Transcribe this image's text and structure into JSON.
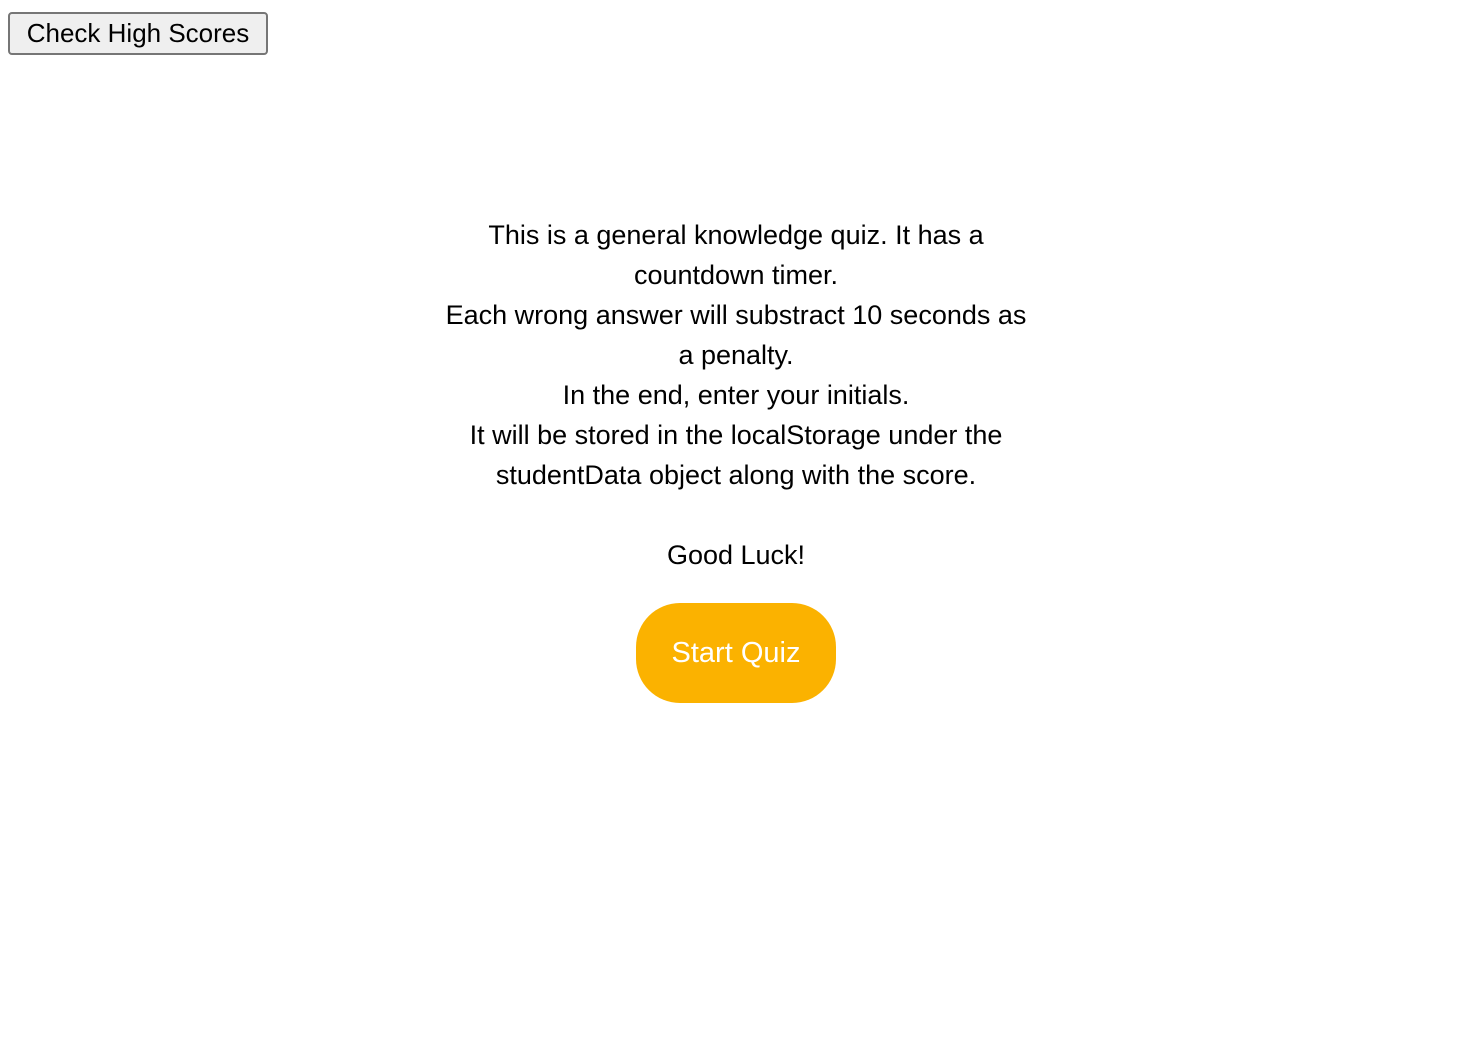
{
  "header": {
    "highscores_label": "Check High Scores"
  },
  "intro": {
    "line1": "This is a general knowledge quiz. It has a countdown timer.",
    "line2": "Each wrong answer will substract 10 seconds as a penalty.",
    "line3": "In the end, enter your initials.",
    "line4": "It will be stored in the localStorage under the studentData object along with the score.",
    "good_luck": "Good Luck!"
  },
  "start": {
    "label": "Start Quiz"
  },
  "colors": {
    "accent": "#fbb200",
    "button_text": "#ffffff"
  }
}
